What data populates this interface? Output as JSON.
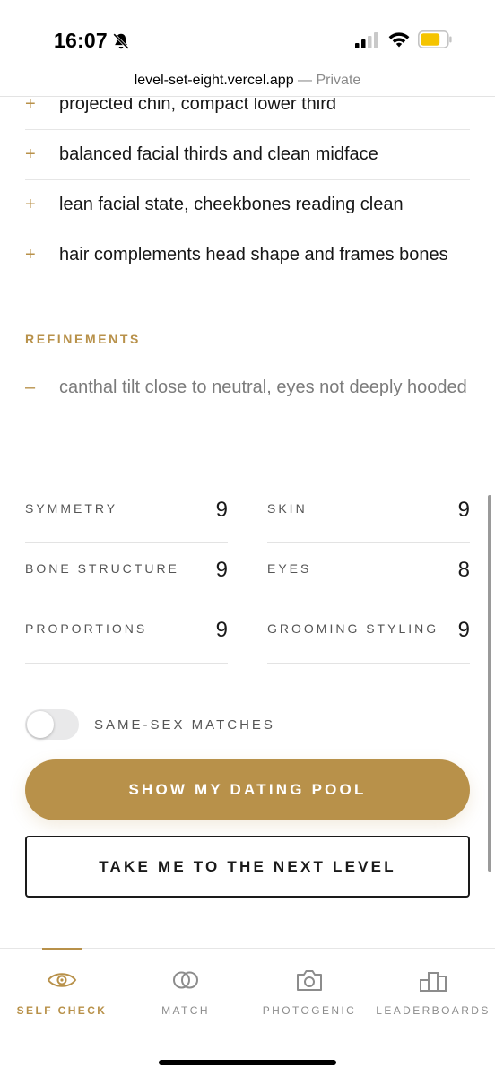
{
  "status_bar": {
    "time": "16:07"
  },
  "browser": {
    "url": "level-set-eight.vercel.app",
    "privacy": " — Private"
  },
  "strengths": [
    {
      "symbol": "+",
      "text": "projected chin, compact lower third"
    },
    {
      "symbol": "+",
      "text": "balanced facial thirds and clean midface"
    },
    {
      "symbol": "+",
      "text": "lean facial state, cheekbones reading clean"
    },
    {
      "symbol": "+",
      "text": "hair complements head shape and frames bones"
    }
  ],
  "refinements": {
    "heading": "REFINEMENTS",
    "items": [
      {
        "symbol": "–",
        "text": "canthal tilt close to neutral, eyes not deeply hooded"
      }
    ]
  },
  "scores": [
    {
      "label": "SYMMETRY",
      "value": "9"
    },
    {
      "label": "SKIN",
      "value": "9"
    },
    {
      "label": "BONE STRUCTURE",
      "value": "9"
    },
    {
      "label": "EYES",
      "value": "8"
    },
    {
      "label": "PROPORTIONS",
      "value": "9"
    },
    {
      "label": "GROOMING STYLING",
      "value": "9"
    }
  ],
  "toggle": {
    "label": "SAME-SEX MATCHES",
    "on": false
  },
  "buttons": {
    "primary": "SHOW MY DATING POOL",
    "secondary": "TAKE ME TO THE NEXT LEVEL"
  },
  "tabs": [
    {
      "label": "SELF CHECK",
      "icon": "eye-icon",
      "active": true
    },
    {
      "label": "MATCH",
      "icon": "rings-icon",
      "active": false
    },
    {
      "label": "PHOTOGENIC",
      "icon": "camera-icon",
      "active": false
    },
    {
      "label": "LEADERBOARDS",
      "icon": "podium-icon",
      "active": false
    }
  ],
  "colors": {
    "accent": "#b8914a",
    "text": "#1a1a1a",
    "muted": "#7b7b7b"
  }
}
